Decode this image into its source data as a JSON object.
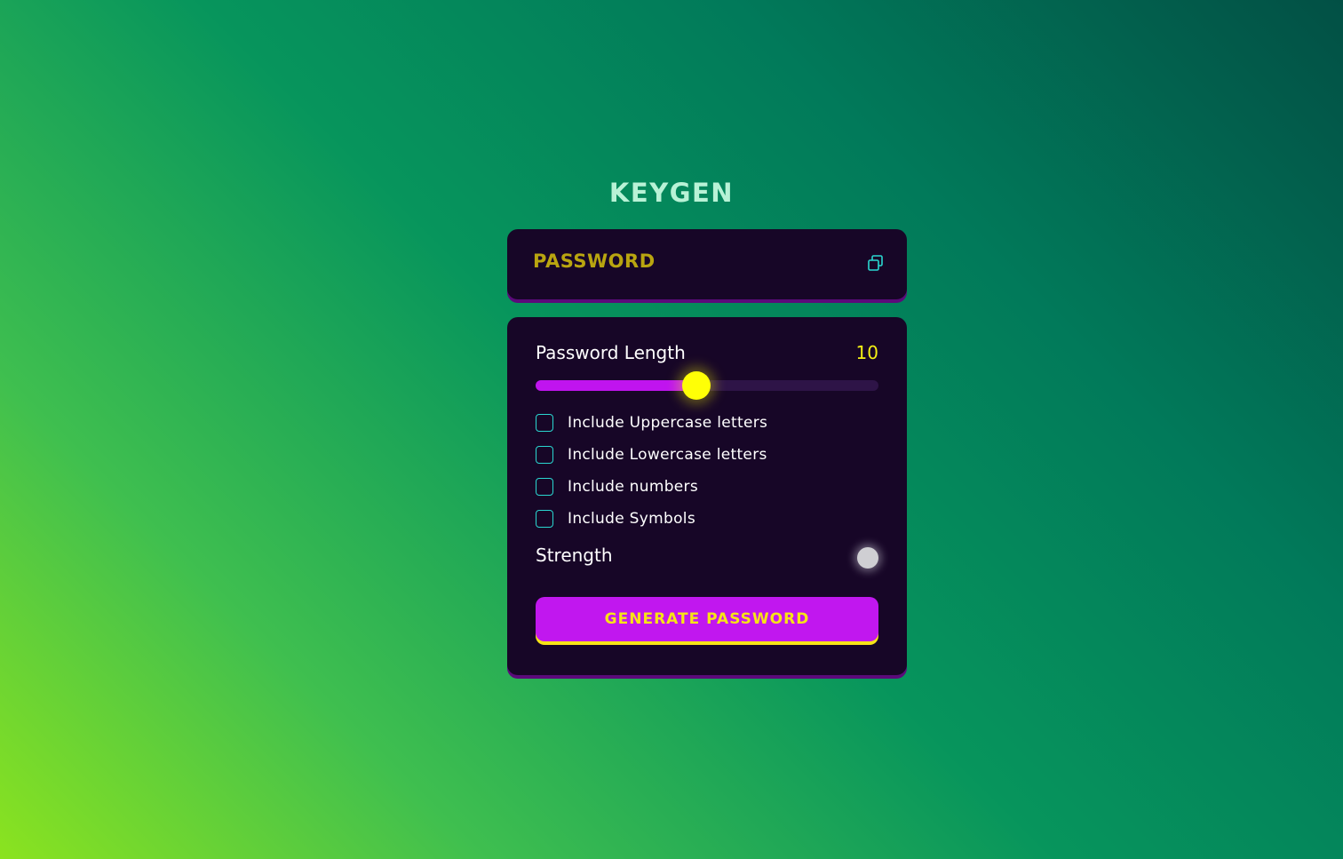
{
  "app": {
    "title": "KEYGEN"
  },
  "password_display": {
    "placeholder_text": "PASSWORD",
    "copy_icon": "copy-icon"
  },
  "length": {
    "label": "Password Length",
    "value": "10",
    "slider_fraction": 0.47
  },
  "options": [
    {
      "label": "Include Uppercase letters",
      "checked": false
    },
    {
      "label": "Include Lowercase letters",
      "checked": false
    },
    {
      "label": "Include numbers",
      "checked": false
    },
    {
      "label": "Include Symbols",
      "checked": false
    }
  ],
  "strength": {
    "label": "Strength"
  },
  "generate_button": {
    "label": "GENERATE PASSWORD"
  },
  "colors": {
    "card_bg": "#170627",
    "accent_purple": "#c117ef",
    "accent_yellow": "#f7e416",
    "checkbox_border": "#2ad7d1"
  }
}
